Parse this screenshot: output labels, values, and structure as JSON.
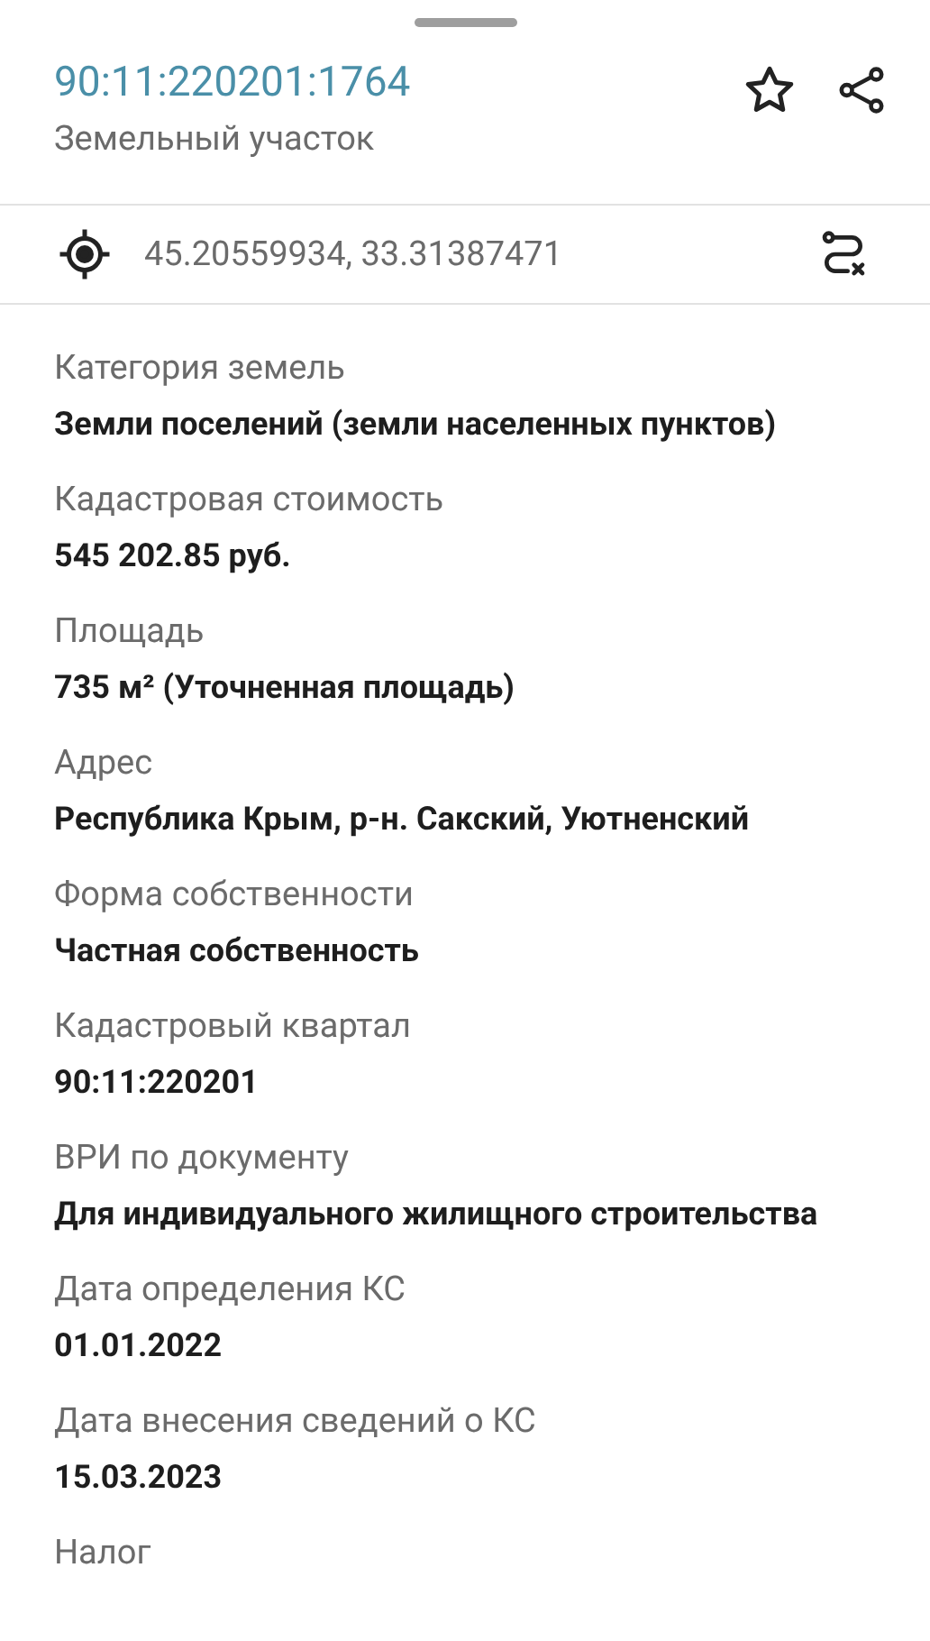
{
  "header": {
    "title": "90:11:220201:1764",
    "subtitle": "Земельный участок"
  },
  "coordinates": "45.20559934, 33.31387471",
  "fields": [
    {
      "label": "Категория земель",
      "value": "Земли поселений (земли населенных пунктов)"
    },
    {
      "label": "Кадастровая стоимость",
      "value": "545 202.85 руб."
    },
    {
      "label": "Площадь",
      "value": "735 м² (Уточненная площадь)"
    },
    {
      "label": "Адрес",
      "value": "Республика Крым, р-н. Сакский, Уютненский"
    },
    {
      "label": "Форма собственности",
      "value": "Частная собственность"
    },
    {
      "label": "Кадастровый квартал",
      "value": "90:11:220201"
    },
    {
      "label": "ВРИ по документу",
      "value": "Для индивидуального жилищного строительства"
    },
    {
      "label": "Дата определения КС",
      "value": "01.01.2022"
    },
    {
      "label": "Дата внесения сведений о КС",
      "value": "15.03.2023"
    },
    {
      "label": "Налог"
    }
  ]
}
